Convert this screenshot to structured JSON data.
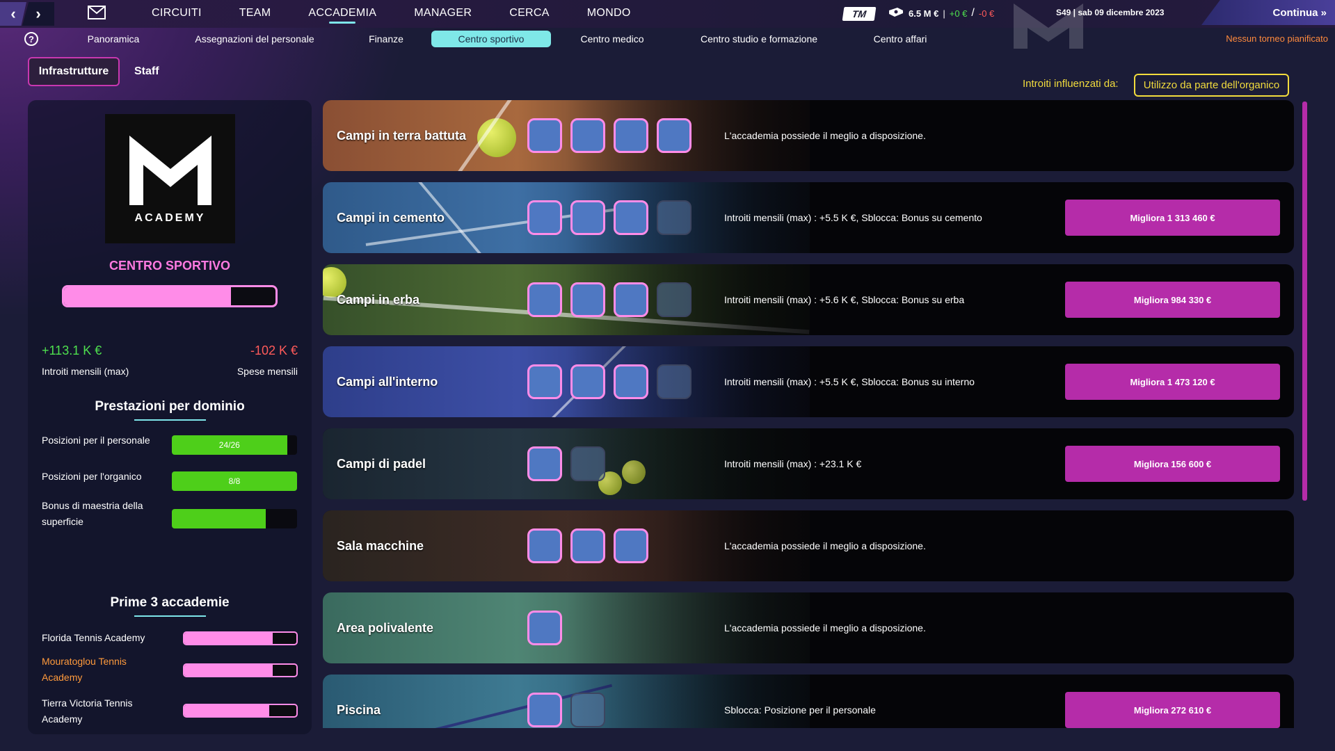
{
  "topbar": {
    "nav": [
      {
        "label": "CIRCUITI"
      },
      {
        "label": "TEAM"
      },
      {
        "label": "ACCADEMIA",
        "active": true
      },
      {
        "label": "MANAGER"
      },
      {
        "label": "CERCA"
      },
      {
        "label": "MONDO"
      }
    ],
    "tm_logo": "TM",
    "balance": "6.5 M €",
    "sep": "|",
    "gain": "+0 €",
    "slash": "/",
    "loss": "-0 €",
    "date": "S49 | sab 09 dicembre 2023",
    "continue": "Continua »"
  },
  "subnav": {
    "help": "?",
    "items": [
      "Panoramica",
      "Assegnazioni del personale",
      "Finanze",
      "Centro sportivo",
      "Centro medico",
      "Centro studio e formazione",
      "Centro affari"
    ],
    "active_index": 3,
    "no_tournament": "Nessun torneo pianificato"
  },
  "tabs": {
    "infra": "Infrastrutture",
    "staff": "Staff"
  },
  "influence": {
    "label": "Introiti influenzati da:",
    "value": "Utilizzo da parte dell'organico"
  },
  "left": {
    "logo_text": "ACADEMY",
    "title": "CENTRO SPORTIVO",
    "main_progress": 0.79,
    "income_value": "+113.1 K €",
    "income_label": "Introiti mensili (max)",
    "expense_value": "-102 K €",
    "expense_label": "Spese mensili",
    "perf_title": "Prestazioni per dominio",
    "perf": [
      {
        "label": "Posizioni per il personale",
        "text": "24/26",
        "fill": 0.92
      },
      {
        "label": "Posizioni per l'organico",
        "text": "8/8",
        "fill": 1.0
      },
      {
        "label": "Bonus di maestria della superficie",
        "text": "",
        "fill": 0.75
      }
    ],
    "top_title": "Prime 3 accademie",
    "top": [
      {
        "label": "Florida Tennis Academy",
        "fill": 0.79,
        "highlight": false
      },
      {
        "label": "Mouratoglou Tennis Academy",
        "fill": 0.79,
        "highlight": true
      },
      {
        "label": "Tierra Victoria Tennis Academy",
        "fill": 0.76,
        "highlight": false
      }
    ]
  },
  "facilities": [
    {
      "name": "Campi in terra battuta",
      "slots_on": 4,
      "slots_off": 0,
      "desc": "L'accademia possiede il meglio a disposizione.",
      "upgrade": ""
    },
    {
      "name": "Campi in cemento",
      "slots_on": 3,
      "slots_off": 1,
      "desc": "Introiti mensili (max) : +5.5 K €, Sblocca: Bonus su cemento",
      "upgrade": "Migliora 1 313 460 €"
    },
    {
      "name": "Campi in erba",
      "slots_on": 3,
      "slots_off": 1,
      "desc": "Introiti mensili (max) : +5.6 K €, Sblocca: Bonus su erba",
      "upgrade": "Migliora 984 330 €"
    },
    {
      "name": "Campi all'interno",
      "slots_on": 3,
      "slots_off": 1,
      "desc": "Introiti mensili (max) : +5.5 K €, Sblocca: Bonus su interno",
      "upgrade": "Migliora 1 473 120 €"
    },
    {
      "name": "Campi di padel",
      "slots_on": 1,
      "slots_off": 1,
      "desc": "Introiti mensili (max) : +23.1 K €",
      "upgrade": "Migliora 156 600 €"
    },
    {
      "name": "Sala macchine",
      "slots_on": 3,
      "slots_off": 0,
      "desc": "L'accademia possiede il meglio a disposizione.",
      "upgrade": ""
    },
    {
      "name": "Area polivalente",
      "slots_on": 1,
      "slots_off": 0,
      "desc": "L'accademia possiede il meglio a disposizione.",
      "upgrade": ""
    },
    {
      "name": "Piscina",
      "slots_on": 1,
      "slots_off": 1,
      "desc": "Sblocca: Posizione per il personale",
      "upgrade": "Migliora 272 610 €"
    }
  ],
  "colors": {
    "accent": "#b52ca9",
    "pink": "#ff8ce8",
    "cyan": "#7ee6ea",
    "green": "#4ecf1a",
    "yellow": "#f2dc3d"
  }
}
